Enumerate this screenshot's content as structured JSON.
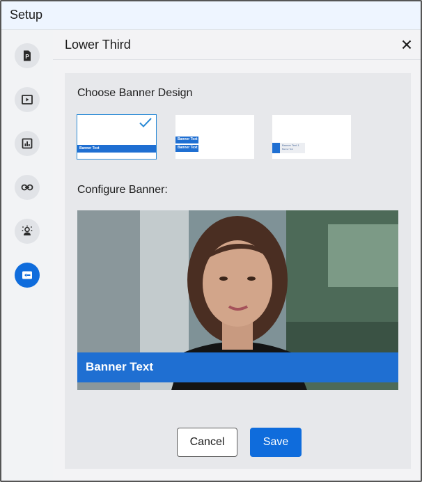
{
  "window": {
    "title": "Setup"
  },
  "sidebar": {
    "items": [
      {
        "icon": "poll-document-icon",
        "active": false
      },
      {
        "icon": "video-icon",
        "active": false
      },
      {
        "icon": "chart-icon",
        "active": false
      },
      {
        "icon": "link-icon",
        "active": false
      },
      {
        "icon": "presenter-icon",
        "active": false
      },
      {
        "icon": "lower-third-icon",
        "active": true
      }
    ]
  },
  "panel": {
    "title": "Lower Third",
    "choose_label": "Choose Banner Design",
    "configure_label": "Configure Banner:",
    "designs": [
      {
        "name": "single-bar",
        "text1": "Banner Text",
        "selected": true
      },
      {
        "name": "double-bar",
        "text1": "Banner Text 1",
        "text2": "Banner Text 2",
        "selected": false
      },
      {
        "name": "accent-light",
        "text1": "Banner Text 1",
        "text2": "Banner Text",
        "selected": false
      }
    ],
    "preview": {
      "banner_text": "Banner Text"
    },
    "cancel_label": "Cancel",
    "save_label": "Save"
  },
  "colors": {
    "accent": "#0f6cdc",
    "banner_blue": "#1f6fd2",
    "selected_border": "#2a8ad6"
  }
}
